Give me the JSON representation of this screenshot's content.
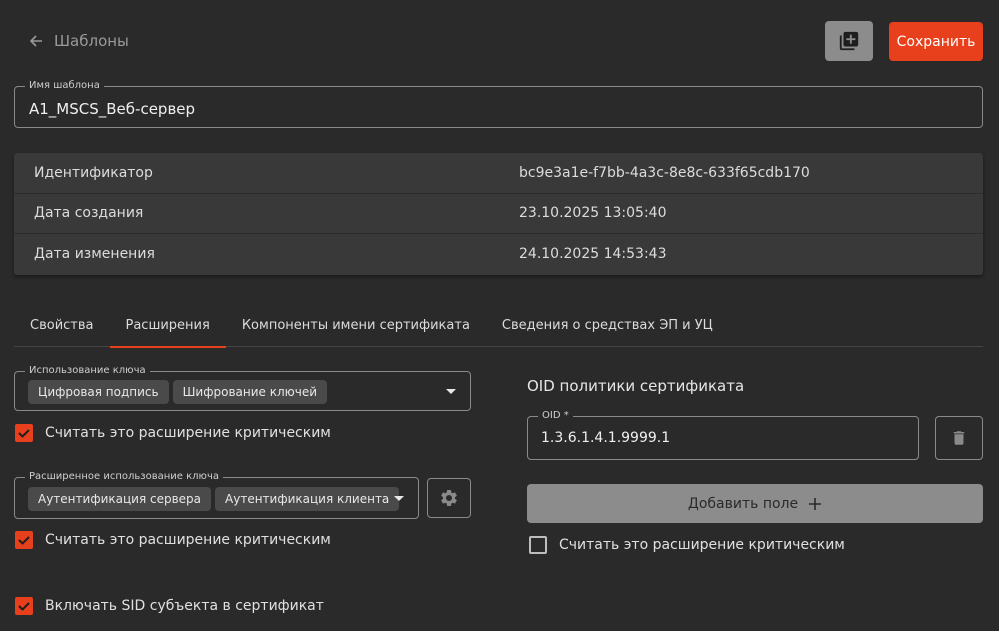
{
  "header": {
    "back_label": "Шаблоны",
    "save_label": "Сохранить"
  },
  "template_name": {
    "label": "Имя шаблона",
    "value": "A1_MSCS_Веб-сервер"
  },
  "info": [
    {
      "key": "Идентификатор",
      "value": "bc9e3a1e-f7bb-4a3c-8e8c-633f65cdb170"
    },
    {
      "key": "Дата создания",
      "value": "23.10.2025 13:05:40"
    },
    {
      "key": "Дата изменения",
      "value": "24.10.2025 14:53:43"
    }
  ],
  "tabs": [
    {
      "label": "Свойства",
      "active": false
    },
    {
      "label": "Расширения",
      "active": true
    },
    {
      "label": "Компоненты имени сертификата",
      "active": false
    },
    {
      "label": "Сведения о средствах ЭП и УЦ",
      "active": false
    }
  ],
  "key_usage": {
    "label": "Использование ключа",
    "chips": [
      "Цифровая подпись",
      "Шифрование ключей"
    ],
    "critical_label": "Считать это расширение критическим",
    "critical_checked": true
  },
  "ext_key_usage": {
    "label": "Расширенное использование ключа",
    "chips": [
      "Аутентификация сервера",
      "Аутентификация клиента"
    ],
    "critical_label": "Считать это расширение критическим",
    "critical_checked": true
  },
  "include_sid": {
    "label": "Включать SID субъекта в сертификат",
    "checked": true
  },
  "oid_policy": {
    "title": "OID политики сертификата",
    "field_label": "OID *",
    "value": "1.3.6.1.4.1.9999.1",
    "add_label": "Добавить поле",
    "critical_label": "Считать это расширение критическим",
    "critical_checked": false
  },
  "colors": {
    "accent": "#e8401c",
    "background": "#2a2a2b",
    "panel": "#393939",
    "button_gray": "#8c8c8c"
  }
}
